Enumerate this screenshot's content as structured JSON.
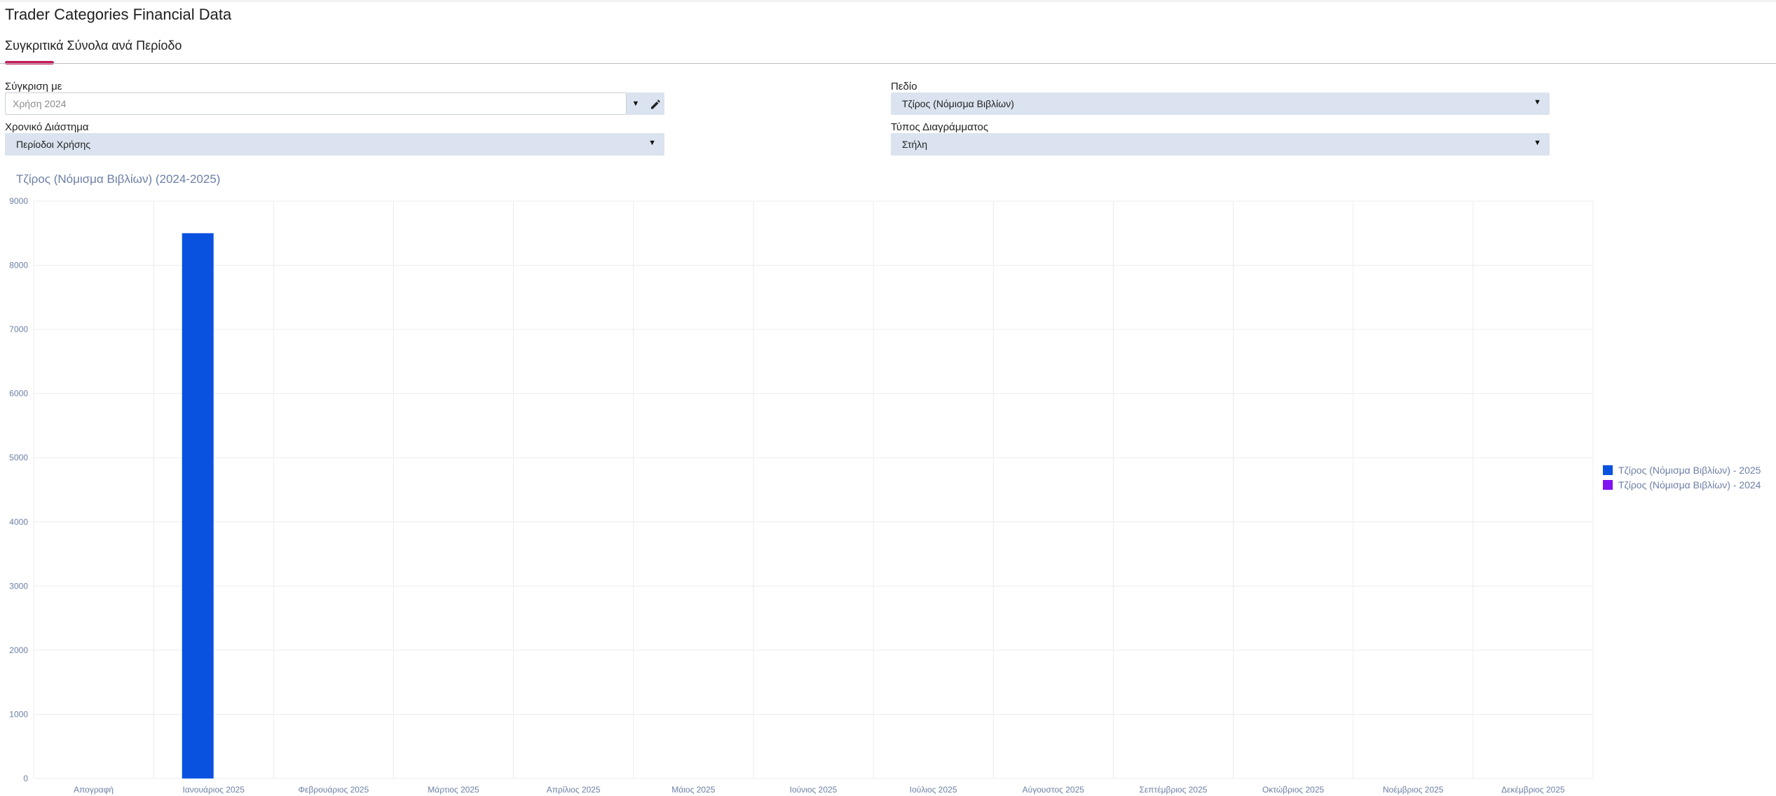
{
  "app": {
    "title": "Trader Categories Financial Data"
  },
  "tabs": [
    {
      "label": "Συγκριτικά Σύνολα ανά Περίοδο",
      "active": true
    }
  ],
  "form": {
    "compare_with": {
      "label": "Σύγκριση με",
      "value": "Χρήση 2024"
    },
    "field": {
      "label": "Πεδίο",
      "value": "Τζίρος (Νόμισμα Βιβλίων)"
    },
    "time_range": {
      "label": "Χρονικό Διάστημα",
      "value": "Περίοδοι Χρήσης"
    },
    "chart_type": {
      "label": "Τύπος Διαγράμματος",
      "value": "Στήλη"
    }
  },
  "icons": {
    "dropdown": "caret-down-icon",
    "edit": "pencil-icon"
  },
  "colors": {
    "accent": "#c2185b",
    "series_2025": "#0952e0",
    "series_2024": "#8213f2",
    "control_bg": "#dae3ef"
  },
  "chart_data": {
    "type": "bar",
    "title": "Τζίρος (Νόμισμα Βιβλίων) (2024-2025)",
    "categories": [
      "Απογραφή",
      "Ιανουάριος 2025",
      "Φεβρουάριος 2025",
      "Μάρτιος 2025",
      "Απρίλιος 2025",
      "Μάιος 2025",
      "Ιούνιος 2025",
      "Ιούλιος 2025",
      "Αύγουστος 2025",
      "Σεπτέμβριος 2025",
      "Οκτώβριος 2025",
      "Νοέμβριος 2025",
      "Δεκέμβριος 2025"
    ],
    "series": [
      {
        "name": "Τζίρος (Νόμισμα Βιβλίων) - 2025",
        "color": "#0952e0",
        "values": [
          0,
          8500,
          0,
          0,
          0,
          0,
          0,
          0,
          0,
          0,
          0,
          0,
          0
        ]
      },
      {
        "name": "Τζίρος (Νόμισμα Βιβλίων) - 2024",
        "color": "#8213f2",
        "values": [
          0,
          0,
          0,
          0,
          0,
          0,
          0,
          0,
          0,
          0,
          0,
          0,
          0
        ]
      }
    ],
    "ylim": [
      0,
      9000
    ],
    "yticks": [
      0,
      1000,
      2000,
      3000,
      4000,
      5000,
      6000,
      7000,
      8000,
      9000
    ],
    "grid": true,
    "legend": "right"
  }
}
